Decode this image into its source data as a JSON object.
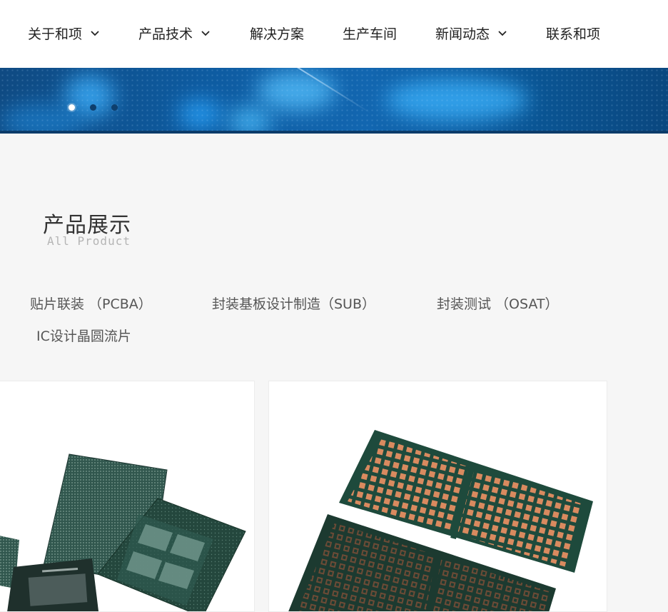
{
  "nav": {
    "items": [
      {
        "label": "关于和项",
        "has_dropdown": true
      },
      {
        "label": "产品技术",
        "has_dropdown": true
      },
      {
        "label": "解决方案",
        "has_dropdown": false
      },
      {
        "label": "生产车间",
        "has_dropdown": false
      },
      {
        "label": "新闻动态",
        "has_dropdown": true
      },
      {
        "label": "联系和项",
        "has_dropdown": false
      }
    ]
  },
  "banner": {
    "slide_count": 3,
    "active_slide": 1
  },
  "section": {
    "title": "产品展示",
    "subtitle": "All Product"
  },
  "categories": [
    "贴片联装 （PCBA）",
    "封装基板设计制造（SUB）",
    "封装测试 （OSAT）",
    "IC设计晶圆流片"
  ],
  "products": [
    {
      "image": "chip-substrates-photo"
    },
    {
      "image": "pcb-panel-photo"
    }
  ],
  "colors": {
    "banner_blue": "#0e5ba0",
    "page_bg": "#f6f6f6",
    "board_green": "#1e4a3c",
    "pad_copper": "#d98a5f"
  }
}
